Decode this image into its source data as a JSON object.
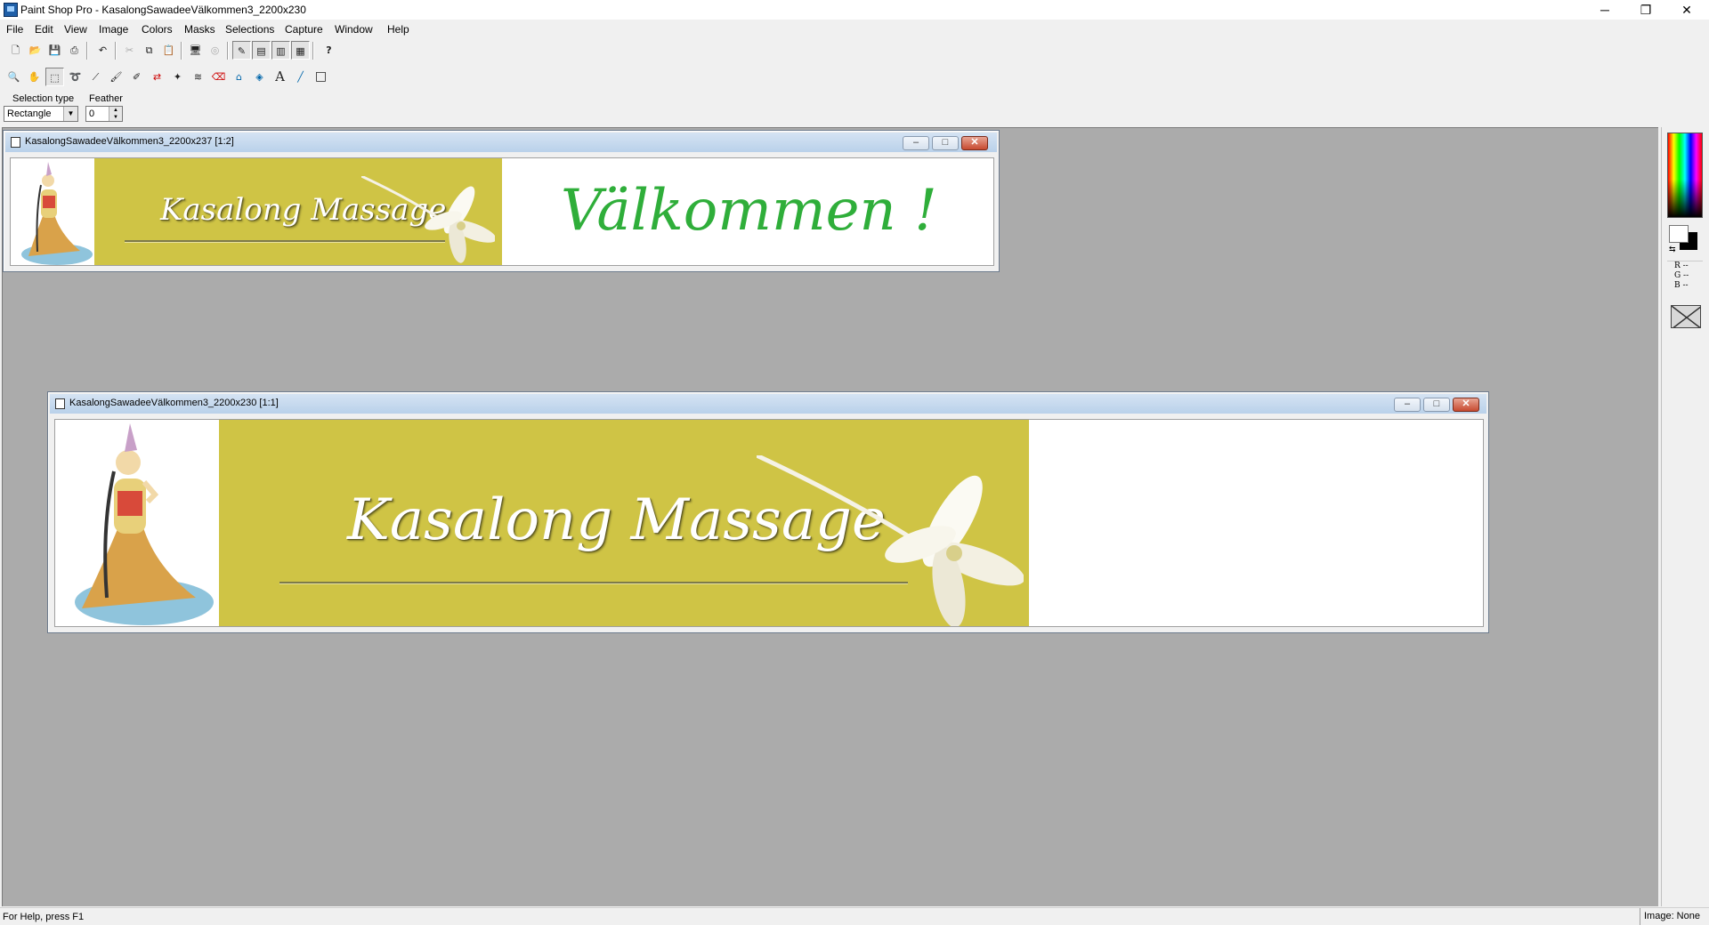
{
  "app": {
    "title": "Paint Shop Pro - KasalongSawadeeVälkommen3_2200x230",
    "caption_buttons": {
      "minimize": "─",
      "restore": "❐",
      "close": "✕"
    }
  },
  "menu": [
    "File",
    "Edit",
    "View",
    "Image",
    "Colors",
    "Masks",
    "Selections",
    "Capture",
    "Window",
    "Help"
  ],
  "toolbar_main": [
    {
      "name": "new-icon",
      "glyph": "🗋"
    },
    {
      "name": "open-icon",
      "glyph": "📂"
    },
    {
      "name": "save-icon",
      "glyph": "💾"
    },
    {
      "name": "print-icon",
      "glyph": "⎙"
    },
    {
      "name": "undo-icon",
      "glyph": "↶"
    },
    {
      "name": "cut-icon",
      "glyph": "✂"
    },
    {
      "name": "copy-icon",
      "glyph": "⧉"
    },
    {
      "name": "paste-icon",
      "glyph": "📋"
    },
    {
      "name": "full-screen-icon",
      "glyph": "🖥"
    },
    {
      "name": "normal-viewing-icon",
      "glyph": "◎"
    },
    {
      "name": "tool-palette-icon",
      "glyph": "✎"
    },
    {
      "name": "style-bar-icon",
      "glyph": "▤"
    },
    {
      "name": "color-palette-icon",
      "glyph": "▥"
    },
    {
      "name": "histogram-icon",
      "glyph": "▦"
    },
    {
      "name": "help-icon",
      "glyph": "?"
    }
  ],
  "toolbar_tools": [
    {
      "name": "zoom-icon",
      "glyph": "🔍"
    },
    {
      "name": "pan-icon",
      "glyph": "✋"
    },
    {
      "name": "selection-icon",
      "glyph": "⬚"
    },
    {
      "name": "lasso-icon",
      "glyph": "➰"
    },
    {
      "name": "eyedropper-icon",
      "glyph": "⟋"
    },
    {
      "name": "paintbrush-icon",
      "glyph": "🖌"
    },
    {
      "name": "clone-brush-icon",
      "glyph": "✐"
    },
    {
      "name": "color-replacer-icon",
      "glyph": "⇄"
    },
    {
      "name": "retouch-icon",
      "glyph": "✦"
    },
    {
      "name": "scratch-remover-icon",
      "glyph": "≋"
    },
    {
      "name": "eraser-icon",
      "glyph": "⌫"
    },
    {
      "name": "picture-tube-icon",
      "glyph": "⌂"
    },
    {
      "name": "flood-fill-icon",
      "glyph": "◈"
    },
    {
      "name": "text-icon",
      "glyph": "A"
    },
    {
      "name": "line-icon",
      "glyph": "╱"
    },
    {
      "name": "shape-icon",
      "glyph": "□"
    }
  ],
  "tool_options": {
    "selection_type_label": "Selection type",
    "selection_type_value": "Rectangle",
    "feather_label": "Feather",
    "feather_value": "0"
  },
  "windows": [
    {
      "title": "KasalongSawadeeVälkommen3_2200x237 [1:2]"
    },
    {
      "title": "KasalongSawadeeVälkommen3_2200x230 [1:1]"
    }
  ],
  "image_text": {
    "brand": "Kasalong  Massage",
    "welcome": "Välkommen !"
  },
  "palette": {
    "r": "R --",
    "g": "G --",
    "b": "B --"
  },
  "status": {
    "help": "For Help, press F1",
    "image": "Image: None"
  },
  "colors": {
    "band": "#cfc445",
    "welcome": "#2fae3a",
    "workspace": "#ababab"
  }
}
